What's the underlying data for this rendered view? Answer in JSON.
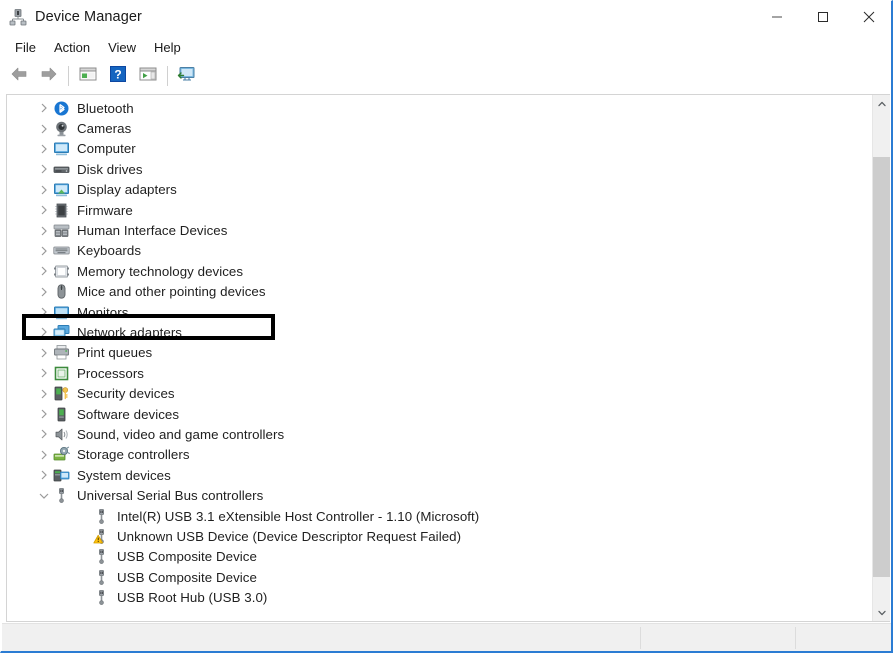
{
  "window": {
    "title": "Device Manager",
    "title_icon": "device-manager-icon",
    "controls": [
      {
        "name": "minimize-button",
        "glyph": "minimize"
      },
      {
        "name": "maximize-button",
        "glyph": "maximize"
      },
      {
        "name": "close-button",
        "glyph": "close"
      }
    ]
  },
  "menubar": {
    "items": [
      {
        "label": "File"
      },
      {
        "label": "Action"
      },
      {
        "label": "View"
      },
      {
        "label": "Help"
      }
    ]
  },
  "toolbar": {
    "buttons": [
      {
        "name": "back-button",
        "icon": "back-arrow-icon"
      },
      {
        "name": "forward-button",
        "icon": "forward-arrow-icon"
      },
      {
        "name": "properties-button",
        "icon": "properties-window-icon"
      },
      {
        "name": "help-button",
        "icon": "help-question-icon"
      },
      {
        "name": "scan-hardware-changes-button",
        "icon": "scan-play-window-icon"
      },
      {
        "name": "update-driver-button",
        "icon": "monitor-update-icon"
      }
    ]
  },
  "tree": {
    "items": [
      {
        "label": "Bluetooth",
        "icon": "bluetooth-icon",
        "expanded": false,
        "level": 0
      },
      {
        "label": "Cameras",
        "icon": "camera-icon",
        "expanded": false,
        "level": 0
      },
      {
        "label": "Computer",
        "icon": "computer-icon",
        "expanded": false,
        "level": 0
      },
      {
        "label": "Disk drives",
        "icon": "disk-drive-icon",
        "expanded": false,
        "level": 0
      },
      {
        "label": "Display adapters",
        "icon": "display-adapter-icon",
        "expanded": false,
        "level": 0
      },
      {
        "label": "Firmware",
        "icon": "firmware-icon",
        "expanded": false,
        "level": 0
      },
      {
        "label": "Human Interface Devices",
        "icon": "hid-icon",
        "expanded": false,
        "level": 0,
        "highlighted": true
      },
      {
        "label": "Keyboards",
        "icon": "keyboard-icon",
        "expanded": false,
        "level": 0
      },
      {
        "label": "Memory technology devices",
        "icon": "memory-icon",
        "expanded": false,
        "level": 0
      },
      {
        "label": "Mice and other pointing devices",
        "icon": "mouse-icon",
        "expanded": false,
        "level": 0
      },
      {
        "label": "Monitors",
        "icon": "monitor-icon",
        "expanded": false,
        "level": 0
      },
      {
        "label": "Network adapters",
        "icon": "network-adapter-icon",
        "expanded": false,
        "level": 0
      },
      {
        "label": "Print queues",
        "icon": "printer-icon",
        "expanded": false,
        "level": 0
      },
      {
        "label": "Processors",
        "icon": "processor-icon",
        "expanded": false,
        "level": 0
      },
      {
        "label": "Security devices",
        "icon": "security-device-icon",
        "expanded": false,
        "level": 0
      },
      {
        "label": "Software devices",
        "icon": "software-device-icon",
        "expanded": false,
        "level": 0
      },
      {
        "label": "Sound, video and game controllers",
        "icon": "speaker-icon",
        "expanded": false,
        "level": 0
      },
      {
        "label": "Storage controllers",
        "icon": "storage-controller-icon",
        "expanded": false,
        "level": 0
      },
      {
        "label": "System devices",
        "icon": "system-device-icon",
        "expanded": false,
        "level": 0
      },
      {
        "label": "Universal Serial Bus controllers",
        "icon": "usb-icon",
        "expanded": true,
        "level": 0
      },
      {
        "label": "Intel(R) USB 3.1 eXtensible Host Controller - 1.10 (Microsoft)",
        "icon": "usb-icon",
        "level": 1
      },
      {
        "label": "Unknown USB Device (Device Descriptor Request Failed)",
        "icon": "usb-warning-icon",
        "level": 1,
        "warning": true
      },
      {
        "label": "USB Composite Device",
        "icon": "usb-icon",
        "level": 1
      },
      {
        "label": "USB Composite Device",
        "icon": "usb-icon",
        "level": 1
      },
      {
        "label": "USB Root Hub (USB 3.0)",
        "icon": "usb-icon",
        "level": 1
      }
    ]
  },
  "scrollbar": {
    "up_arrow": "scroll-up-icon",
    "down_arrow": "scroll-down-icon"
  },
  "statusbar": {
    "text": ""
  },
  "colors": {
    "window_border": "#2b7cd3",
    "annotation": "#000000",
    "warning": "#ffc20e",
    "text": "#1f1f1f",
    "chevron": "#9a9a9a",
    "statusbar_bg": "#f0f0f0"
  }
}
